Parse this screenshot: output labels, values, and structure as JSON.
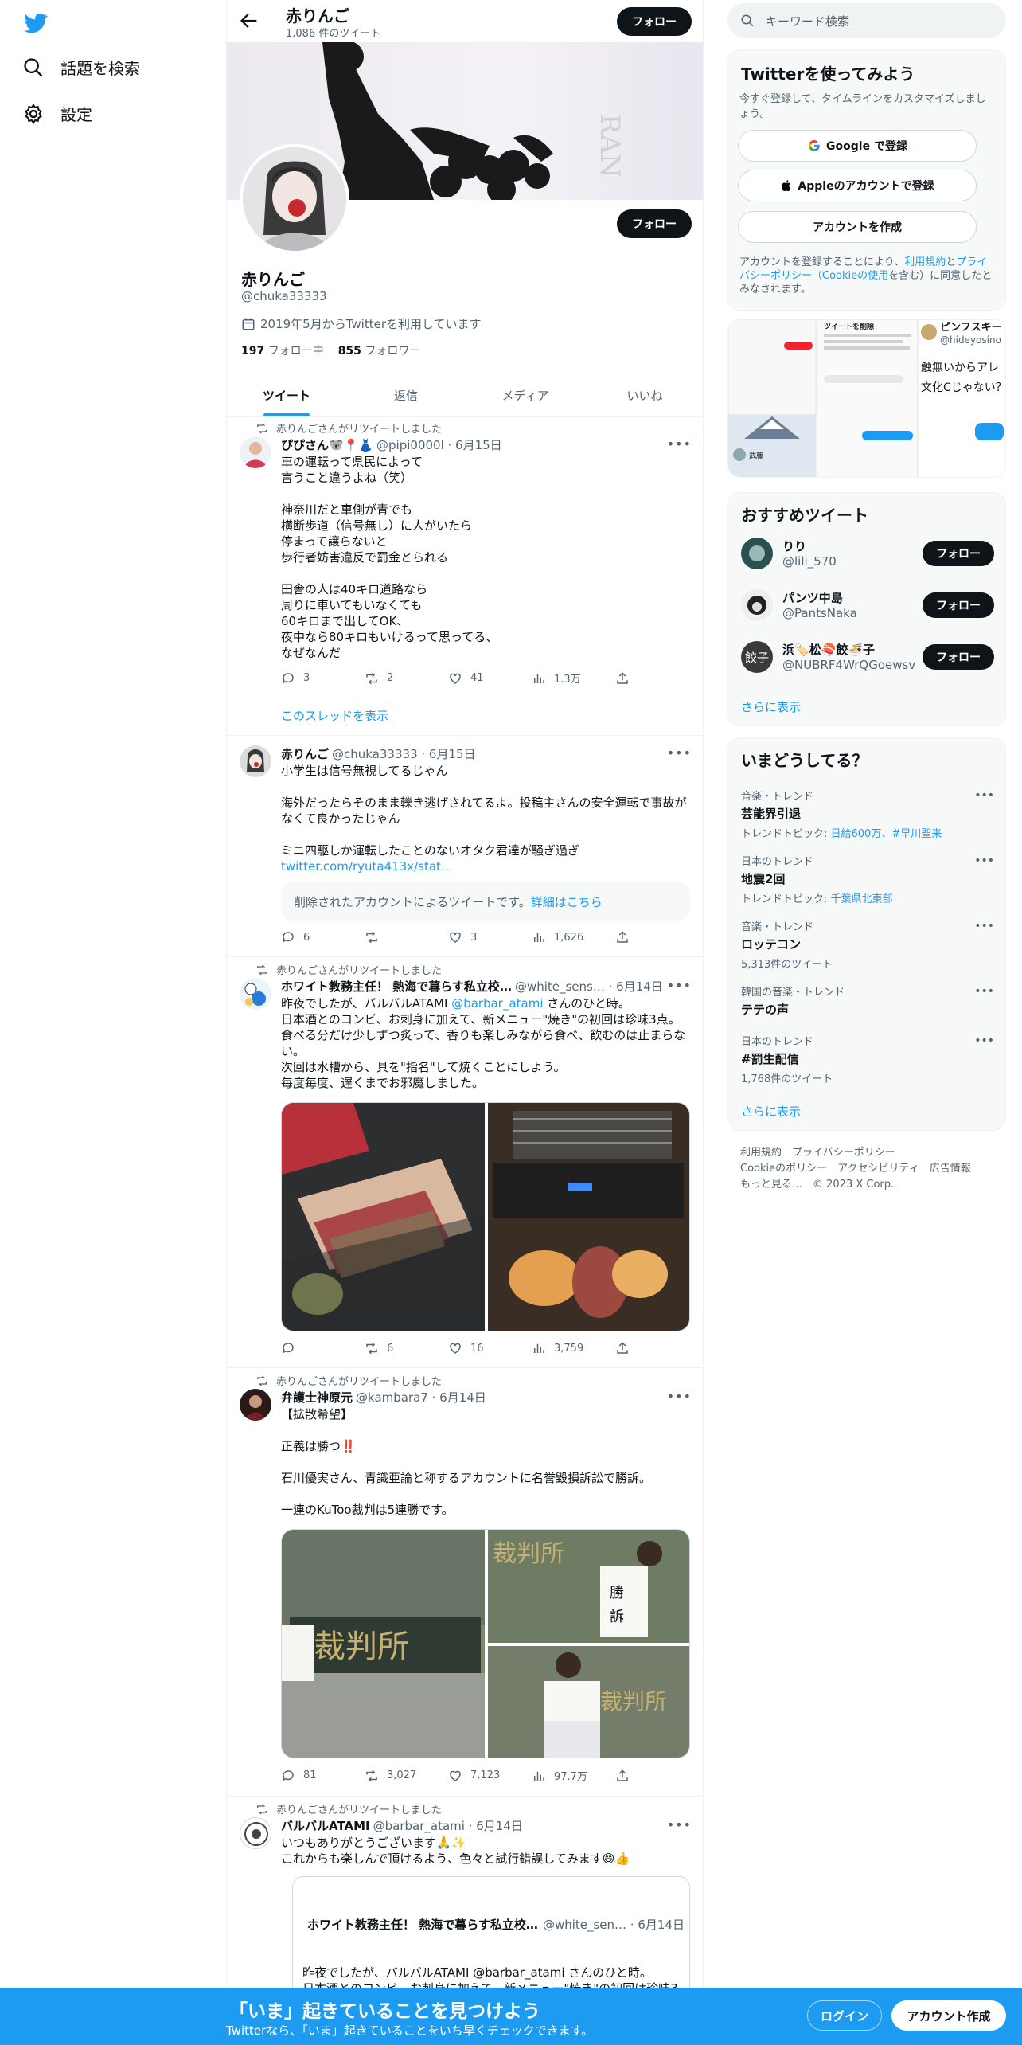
{
  "nav": {
    "search_label": "話題を検索",
    "settings_label": "設定"
  },
  "header": {
    "name": "赤りんご",
    "tweet_count": "1,086 件のツイート",
    "follow_label": "フォロー"
  },
  "profile": {
    "display_name": "赤りんご",
    "handle": "@chuka33333",
    "joined": "2019年5月からTwitterを利用しています",
    "following_count": "197",
    "following_label": "フォロー中",
    "followers_count": "855",
    "followers_label": "フォロワー",
    "follow_label": "フォロー"
  },
  "tabs": [
    {
      "label": "ツイート",
      "active": true
    },
    {
      "label": "返信",
      "active": false
    },
    {
      "label": "メディア",
      "active": false
    },
    {
      "label": "いいね",
      "active": false
    }
  ],
  "tweets": [
    {
      "retweet_by": "赤りんごさんがリツイートしました",
      "name": "ぴぴさん🐨📍👗",
      "meta": "@pipi0000l · 6月15日",
      "text": "車の運転って県民によって\n言うこと違うよね（笑）\n\n神奈川だと車側が青でも\n横断歩道（信号無し）に人がいたら\n停まって譲らないと\n歩行者妨害違反で罰金とられる\n\n田舎の人は40キロ道路なら\n周りに車いてもいなくても\n60キロまで出してOK、\n夜中なら80キロもいけるって思ってる、\nなぜなんだ",
      "replies": "3",
      "retweets": "2",
      "likes": "41",
      "views": "1.3万",
      "thread_link": "このスレッドを表示"
    },
    {
      "name": "赤りんご",
      "meta": "@chuka33333 · 6月15日",
      "text": "小学生は信号無視してるじゃん\n\n海外だったらそのまま轢き逃げされてるよ。投稿主さんの安全運転で事故がなくて良かったじゃん\n\nミニ四駆しか運転したことのないオタク君達が騒ぎ過ぎ",
      "link": "twitter.com/ryuta413x/stat…",
      "deleted_text": "削除されたアカウントによるツイートです。",
      "deleted_link": "詳細はこちら",
      "replies": "6",
      "retweets": "",
      "likes": "3",
      "views": "1,626"
    },
    {
      "retweet_by": "赤りんごさんがリツイートしました",
      "name": "ホワイト教務主任！ 熱海で暮らす私立校…",
      "meta": "@white_sens… · 6月14日",
      "text_pre": "昨夜でしたが、バルバルATAMI ",
      "mention": "@barbar_atami",
      "text_post": " さんのひと時。\n日本酒とのコンビ、お刺身に加えて、新メニュー\"焼き\"の初回は珍味3点。食べる分だけ少しずつ炙って、香りも楽しみながら食べ、飲むのは止まらない。\n次回は水槽から、具を\"指名\"して焼くことにしよう。\n毎度毎度、遅くまでお邪魔しました。",
      "replies": "",
      "retweets": "6",
      "likes": "16",
      "views": "3,759"
    },
    {
      "retweet_by": "赤りんごさんがリツイートしました",
      "name": "弁護士神原元",
      "meta": "@kambara7 · 6月14日",
      "text": "【拡散希望】\n\n正義は勝つ‼️\n\n石川優実さん、青識亜論と称するアカウントに名誉毀損訴訟で勝訴。\n\n一連のKuToo裁判は5連勝です。",
      "replies": "81",
      "retweets": "3,027",
      "likes": "7,123",
      "views": "97.7万"
    },
    {
      "retweet_by": "赤りんごさんがリツイートしました",
      "name": "バルバルATAMI",
      "meta": "@barbar_atami · 6月14日",
      "text": "いつもありがとうございます🙏✨\nこれからも楽しんで頂けるよう、色々と試行錯誤してみます😄👍",
      "quote_name": "ホワイト教務主任！ 熱海で暮らす私立校…",
      "quote_meta": "@white_sen… · 6月14日",
      "quote_text": "昨夜でしたが、バルバルATAMI @barbar_atami さんのひと時。\n日本酒とのコンビ、お刺身に加えて、新メニュー\"焼き\"の初回は珍味3点。食べる分だけ少しずつ炙って、香りも楽しみながら食べ、飲むのは止まらない。\n次回は水槽から、具を\"指名\"して焼くことにしよう。"
    }
  ],
  "right": {
    "search_placeholder": "キーワード検索",
    "signup": {
      "title": "Twitterを使ってみよう",
      "subtitle": "今すぐ登録して、タイムラインをカスタマイズしましょう。",
      "google": "Google で登録",
      "apple": "Appleのアカウントで登録",
      "create": "アカウントを作成",
      "terms_pre": "アカウントを登録することにより、",
      "terms_link1": "利用規約",
      "terms_mid": "と",
      "terms_link2": "プライバシーポリシー（Cookieの使用",
      "terms_post": "を含む）に同意したとみなされます。"
    },
    "media_preview": {
      "name": "ピンフスキー",
      "handle": "@hideyosino",
      "text": "触無いからアレ文化Cじゃない？",
      "delete_title": "ツイートを削除",
      "user_label": "武藤"
    },
    "recommend": {
      "title": "おすすめツイート",
      "users": [
        {
          "name": "りり",
          "handle": "@lili_570",
          "follow": "フォロー"
        },
        {
          "name": "パンツ中島",
          "handle": "@PantsNaka",
          "follow": "フォロー"
        },
        {
          "name": "浜🏷️松🍣餃🍜子",
          "handle": "@NUBRF4WrQGoewsv",
          "follow": "フォロー"
        }
      ],
      "more": "さらに表示"
    },
    "trends": {
      "title": "いまどうしてる？",
      "items": [
        {
          "category": "音楽・トレンド",
          "name": "芸能界引退",
          "extra_pre": "トレンドトピック: ",
          "extra_link": "日給600万、#早川聖来"
        },
        {
          "category": "日本のトレンド",
          "name": "地震2回",
          "extra_pre": "トレンドトピック: ",
          "extra_link": "千葉県北東部"
        },
        {
          "category": "音楽・トレンド",
          "name": "ロッテコン",
          "extra_pre": "5,313件のツイート",
          "extra_link": ""
        },
        {
          "category": "韓国の音楽・トレンド",
          "name": "テテの声",
          "extra_pre": "",
          "extra_link": ""
        },
        {
          "category": "日本のトレンド",
          "name": "#罰生配信",
          "extra_pre": "1,768件のツイート",
          "extra_link": ""
        }
      ],
      "more": "さらに表示"
    },
    "footer": {
      "line1": "利用規約　プライバシーポリシー",
      "line2": "Cookieのポリシー　アクセシビリティ　広告情報",
      "line3": "もっと見る…　© 2023 X Corp."
    }
  },
  "bottom": {
    "title": "「いま」起きていることを見つけよう",
    "subtitle": "Twitterなら、「いま」起きていることをいち早くチェックできます。",
    "login": "ログイン",
    "signup": "アカウント作成"
  },
  "colors": {
    "accent": "#1d9bf0",
    "text": "#0f1419",
    "secondary": "#536471"
  }
}
